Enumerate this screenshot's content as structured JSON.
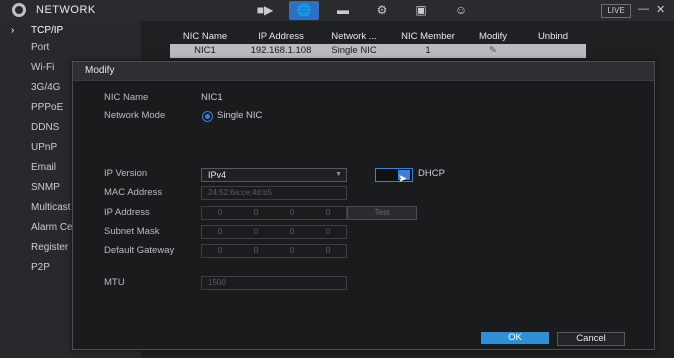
{
  "app": {
    "title": "NETWORK"
  },
  "toolbar": {
    "icons": [
      "camera-icon",
      "network-icon",
      "storage-icon",
      "settings-icon",
      "security-icon",
      "account-icon"
    ],
    "live_label": "LIVE",
    "minimize": "—",
    "close": "✕"
  },
  "sidebar": {
    "items": [
      {
        "label": "TCP/IP"
      },
      {
        "label": "Port"
      },
      {
        "label": "Wi-Fi"
      },
      {
        "label": "3G/4G"
      },
      {
        "label": "PPPoE"
      },
      {
        "label": "DDNS"
      },
      {
        "label": "UPnP"
      },
      {
        "label": "Email"
      },
      {
        "label": "SNMP"
      },
      {
        "label": "Multicast"
      },
      {
        "label": "Alarm Center"
      },
      {
        "label": "Register"
      },
      {
        "label": "P2P"
      }
    ]
  },
  "nic_table": {
    "headers": [
      "NIC Name",
      "IP Address",
      "Network ...",
      "NIC Member",
      "Modify",
      "Unbind"
    ],
    "rows": [
      {
        "nic_name": "NIC1",
        "ip_address": "192.168.1.108",
        "network_mode": "Single NIC",
        "nic_member": "1",
        "modify_icon": "pencil-icon",
        "unbind": ""
      }
    ]
  },
  "dialog": {
    "title": "Modify",
    "nic_name_label": "NIC Name",
    "nic_name_value": "NIC1",
    "network_mode_label": "Network Mode",
    "network_mode_value": "Single NIC",
    "ip_version_label": "IP Version",
    "ip_version_value": "IPv4",
    "dhcp_label": "DHCP",
    "dhcp_enabled": true,
    "mac_label": "MAC Address",
    "mac_value": "24:52:6a:ce:4d:b5",
    "ip_address_label": "IP Address",
    "ip_address_octets": [
      "0",
      "0",
      "0",
      "0"
    ],
    "test_label": "Test",
    "subnet_mask_label": "Subnet Mask",
    "subnet_mask_octets": [
      "0",
      "0",
      "0",
      "0"
    ],
    "gateway_label": "Default Gateway",
    "gateway_octets": [
      "0",
      "0",
      "0",
      "0"
    ],
    "mtu_label": "MTU",
    "mtu_value": "1500",
    "ok_label": "OK",
    "cancel_label": "Cancel"
  },
  "colors": {
    "accent": "#2f8fd6",
    "active_tab": "#2f6fc2",
    "background": "#1c1c1e"
  }
}
